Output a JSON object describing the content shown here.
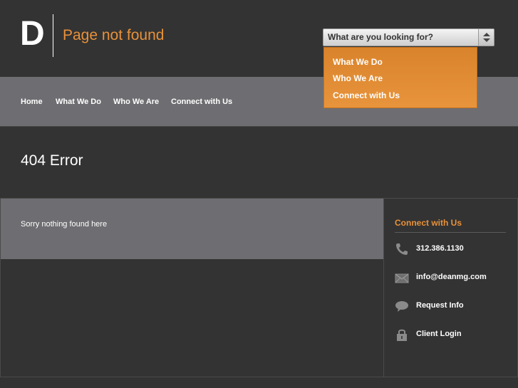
{
  "header": {
    "logo_letter": "D",
    "page_title": "Page not found"
  },
  "search_select": {
    "selected": "What are you looking for?",
    "options": [
      "What We Do",
      "Who We Are",
      "Connect with Us"
    ]
  },
  "nav": {
    "items": [
      "Home",
      "What We Do",
      "Who We Are",
      "Connect with Us"
    ]
  },
  "main": {
    "error_title": "404 Error",
    "message": "Sorry nothing found here"
  },
  "sidebar": {
    "title": "Connect with Us",
    "contacts": [
      {
        "icon": "phone-icon",
        "label": "312.386.1130"
      },
      {
        "icon": "mail-icon",
        "label": "info@deanmg.com"
      },
      {
        "icon": "speech-bubble-icon",
        "label": "Request Info"
      },
      {
        "icon": "lock-icon",
        "label": "Client Login"
      }
    ]
  },
  "colors": {
    "accent": "#e8913a",
    "background": "#333333",
    "band": "#6e6e72"
  }
}
